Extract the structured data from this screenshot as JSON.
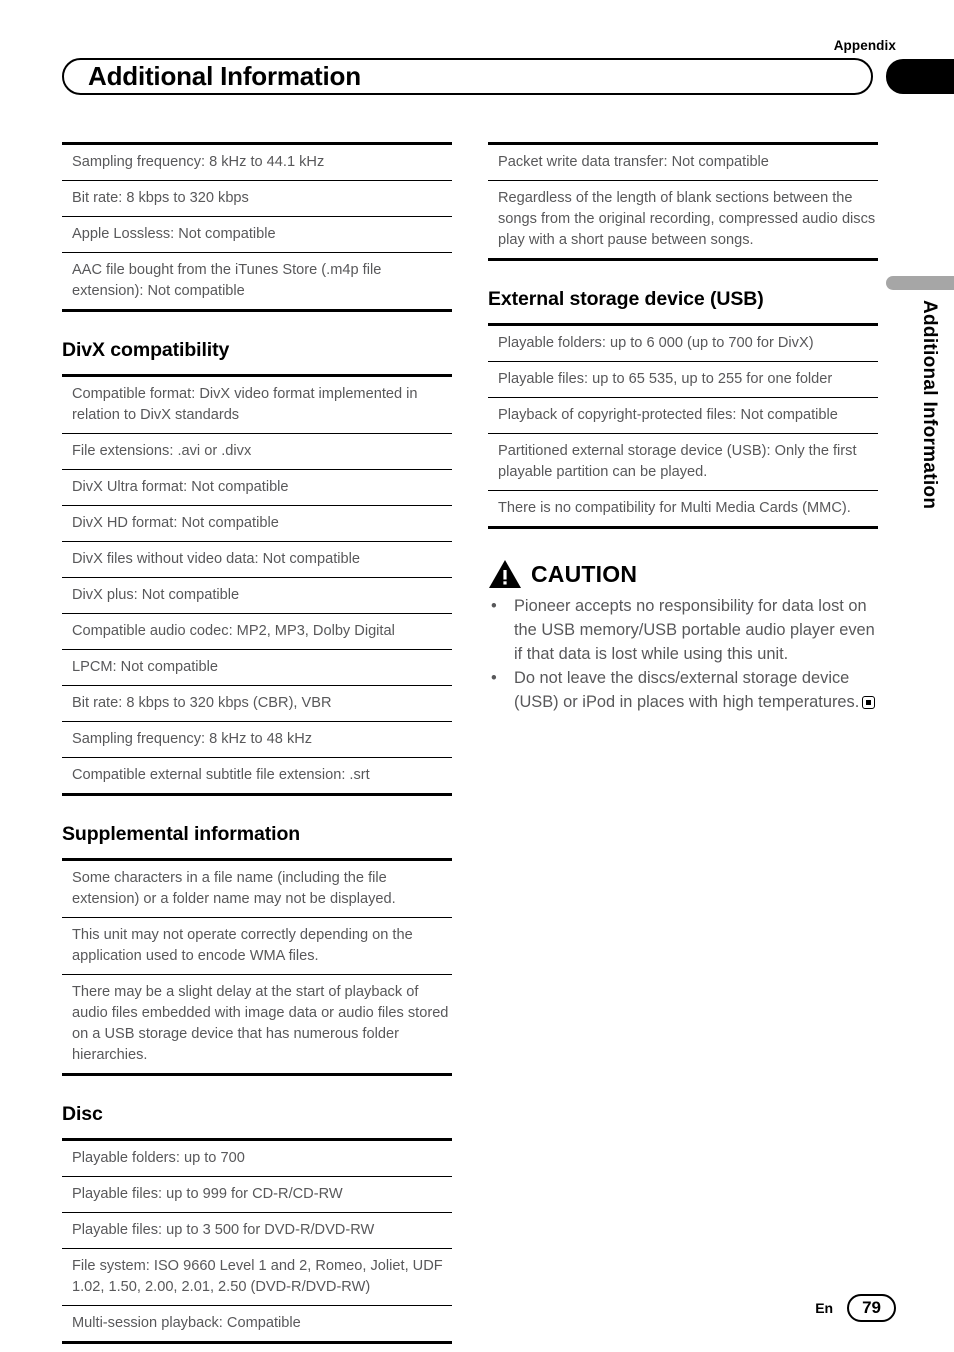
{
  "header": {
    "appendix_label": "Appendix",
    "chapter_title": "Additional Information"
  },
  "side_tab": {
    "label": "Additional Information"
  },
  "left_column": {
    "table_continued": {
      "rows": [
        "Sampling frequency: 8 kHz to 44.1 kHz",
        "Bit rate: 8 kbps to 320 kbps",
        "Apple Lossless: Not compatible",
        "AAC file bought from the iTunes Store (.m4p file extension): Not compatible"
      ]
    },
    "divx": {
      "heading": "DivX compatibility",
      "rows": [
        "Compatible format: DivX video format implemented in relation to DivX standards",
        "File extensions: .avi or .divx",
        "DivX Ultra format: Not compatible",
        "DivX HD format: Not compatible",
        "DivX files without video data: Not compatible",
        "DivX plus: Not compatible",
        "Compatible audio codec: MP2, MP3, Dolby Digital",
        "LPCM: Not compatible",
        "Bit rate: 8 kbps to 320 kbps (CBR), VBR",
        "Sampling frequency: 8 kHz to 48 kHz",
        "Compatible external subtitle file extension: .srt"
      ]
    },
    "supplemental": {
      "heading": "Supplemental information",
      "rows": [
        "Some characters in a file name (including the file extension) or a folder name may not be displayed.",
        "This unit may not operate correctly depending on the application used to encode WMA files.",
        "There may be a slight delay at the start of playback of audio files embedded with image data or audio files stored on a USB storage device that has numerous folder hierarchies."
      ]
    },
    "disc": {
      "heading": "Disc",
      "rows": [
        "Playable folders: up to 700",
        "Playable files: up to 999 for CD-R/CD-RW",
        "Playable files: up to 3 500 for DVD-R/DVD-RW",
        "File system: ISO 9660 Level 1 and 2, Romeo, Joliet, UDF 1.02, 1.50, 2.00, 2.01, 2.50 (DVD-R/DVD-RW)",
        "Multi-session playback: Compatible"
      ]
    }
  },
  "right_column": {
    "table_continued": {
      "rows": [
        "Packet write data transfer: Not compatible",
        "Regardless of the length of blank sections between the songs from the original recording, compressed audio discs play with a short pause between songs."
      ]
    },
    "usb": {
      "heading": "External storage device (USB)",
      "rows": [
        "Playable folders: up to 6 000 (up to 700 for DivX)",
        "Playable files: up to 65 535, up to 255 for one folder",
        "Playback of copyright-protected files: Not compatible",
        "Partitioned external storage device (USB): Only the first playable partition can be played.",
        "There is no compatibility for Multi Media Cards (MMC)."
      ]
    },
    "caution": {
      "heading": "CAUTION",
      "bullet_char": "•",
      "items": [
        "Pioneer accepts no responsibility for data lost on the USB memory/USB portable audio player even if that data is lost while using this unit.",
        "Do not leave the discs/external storage device (USB) or iPod in places with high temperatures."
      ],
      "last_item_has_end_mark": true
    }
  },
  "footer": {
    "language": "En",
    "page_number": "79"
  },
  "colors": {
    "body_text": "#58585a",
    "heading_text": "#000000",
    "rule": "#000000",
    "side_tab_bar": "#a6a6a6"
  }
}
